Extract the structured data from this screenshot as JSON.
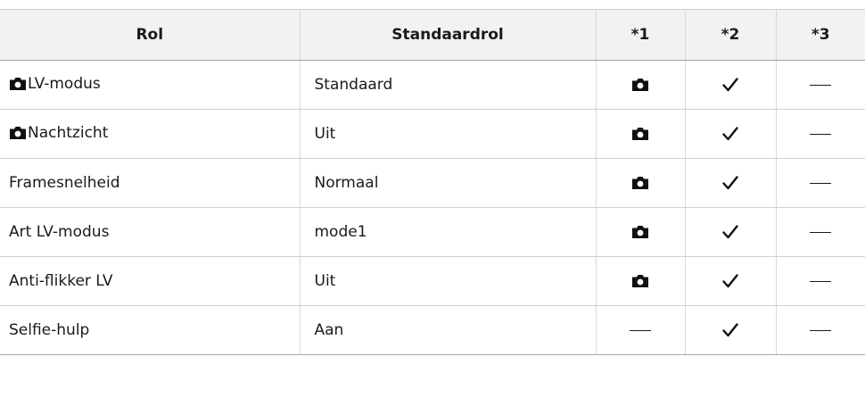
{
  "table": {
    "headers": {
      "role": "Rol",
      "default": "Standaardrol",
      "s1": "*1",
      "s2": "*2",
      "s3": "*3"
    },
    "rows": [
      {
        "role": "LV-modus",
        "role_icon": "camera-icon",
        "default": "Standaard",
        "s1": "camera-icon",
        "s2": "check-icon",
        "s3": "dash"
      },
      {
        "role": "Nachtzicht",
        "role_icon": "camera-icon",
        "default": "Uit",
        "s1": "camera-icon",
        "s2": "check-icon",
        "s3": "dash"
      },
      {
        "role": "Framesnelheid",
        "role_icon": "",
        "default": "Normaal",
        "s1": "camera-icon",
        "s2": "check-icon",
        "s3": "dash"
      },
      {
        "role": "Art LV-modus",
        "role_icon": "",
        "default": "mode1",
        "s1": "camera-icon",
        "s2": "check-icon",
        "s3": "dash"
      },
      {
        "role": "Anti-flikker LV",
        "role_icon": "",
        "default": "Uit",
        "s1": "camera-icon",
        "s2": "check-icon",
        "s3": "dash"
      },
      {
        "role": "Selfie-hulp",
        "role_icon": "",
        "default": "Aan",
        "s1": "dash",
        "s2": "check-icon",
        "s3": "dash"
      }
    ]
  }
}
